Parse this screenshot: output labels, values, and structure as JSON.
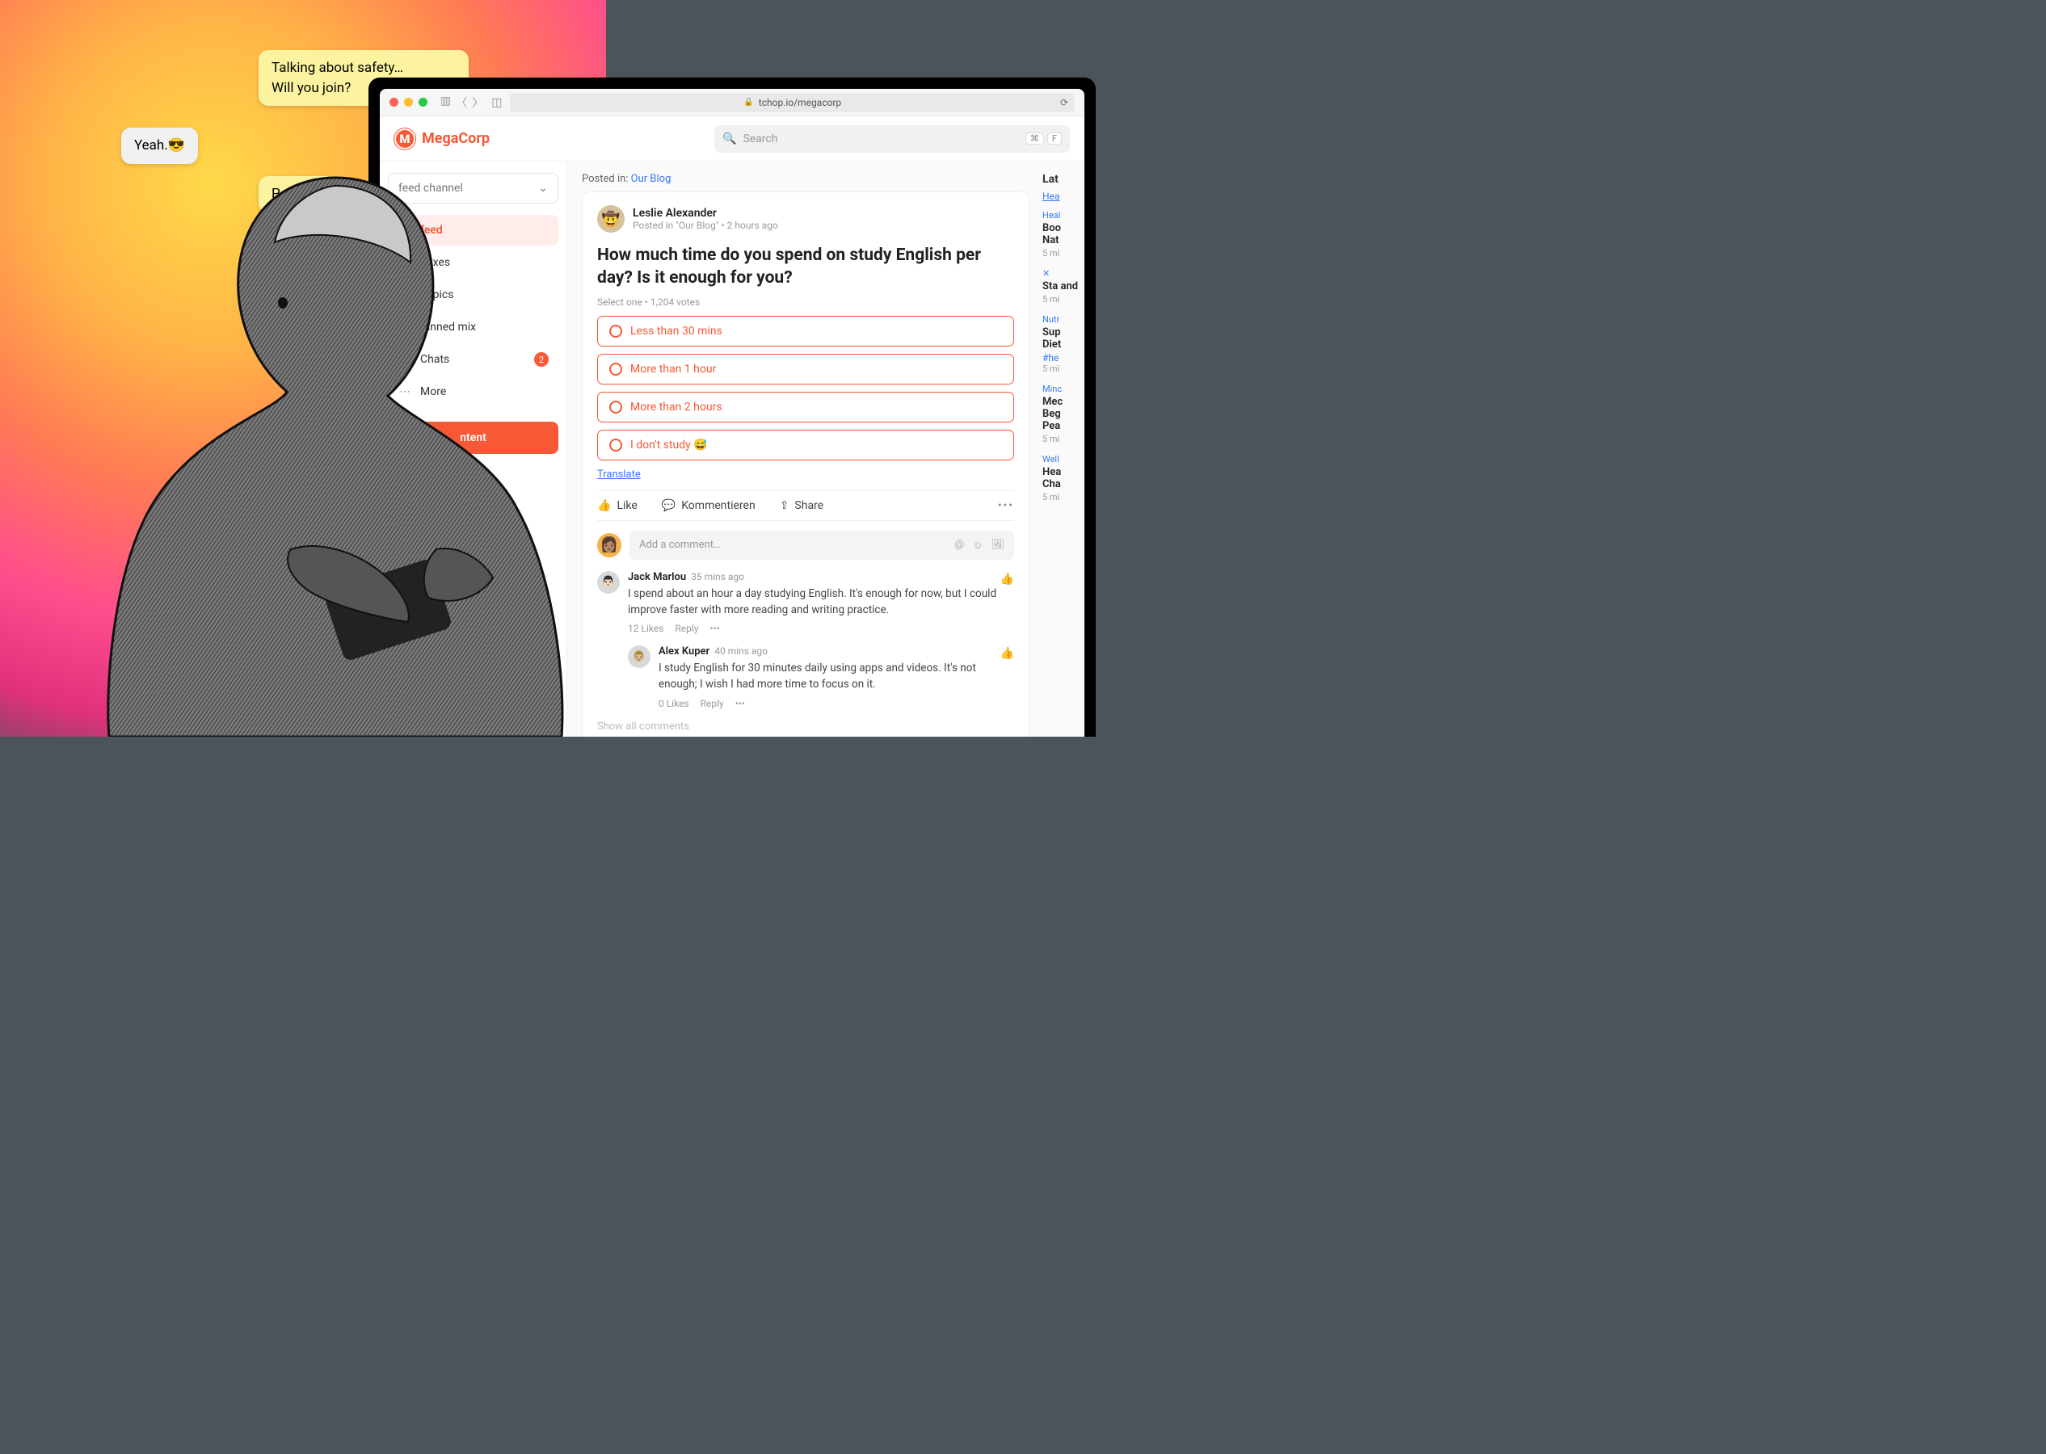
{
  "bubbles": {
    "safety_line1": "Talking about safety…",
    "safety_line2": "Will you join?",
    "yeah": "Yeah.😎",
    "perf": "Perf                    you"
  },
  "browser": {
    "url": "tchop.io/megacorp",
    "kbd1": "⌘",
    "kbd2": "F"
  },
  "header": {
    "brand_letter": "M",
    "brand": "MegaCorp",
    "search_placeholder": "Search"
  },
  "sidebar": {
    "channel_label": "feed channel",
    "items": [
      {
        "icon": "🏠",
        "label": "feed"
      },
      {
        "icon": "▦",
        "label": "Mixes"
      },
      {
        "icon": "☷",
        "label": "Topics"
      },
      {
        "icon": "📌",
        "label": "Pinned mix"
      },
      {
        "icon": "💬",
        "label": "Chats",
        "badge": "2"
      },
      {
        "icon": "⋯",
        "label": "More"
      }
    ],
    "new_content": "ntent"
  },
  "post": {
    "posted_in_prefix": "Posted in:",
    "posted_in_link": "Our Blog",
    "author": "Leslie Alexander",
    "meta": "Posted in \"Our Blog\" • 2 hours ago",
    "title": "How much time do you spend on study English per day? Is it enough for you?",
    "vote_meta": "Select one • 1,204 votes",
    "options": [
      "Less than 30 mins",
      "More than 1 hour",
      "More than 2 hours",
      "I don't study 😅"
    ],
    "translate": "Translate",
    "actions": {
      "like": "Like",
      "comment": "Kommentieren",
      "share": "Share"
    },
    "comment_placeholder": "Add a comment…",
    "comments": [
      {
        "name": "Jack Marlou",
        "time": "35 mins ago",
        "text": "I spend about an hour a day studying English. It's enough for now, but I could improve faster with more reading and writing practice.",
        "likes": "12  Likes",
        "reply": "Reply",
        "liked": true
      },
      {
        "name": "Alex Kuper",
        "time": "40 mins ago",
        "text": "I study English for 30 minutes daily using apps and videos. It's not enough; I wish I had more time to focus on it.",
        "likes": "0  Likes",
        "reply": "Reply",
        "liked": false
      }
    ],
    "show_all": "Show all comments"
  },
  "rail": {
    "heading": "Lat",
    "link": "Hea",
    "sections": [
      {
        "tag": "Heal",
        "title": "Boo\nNat",
        "when": "5 mi"
      },
      {
        "tag": "✕",
        "title": "Sta\nand",
        "when": "5 mi"
      },
      {
        "tag": "Nutr",
        "title": "Sup\nDiet",
        "hashtag": "#he",
        "when": "5 mi"
      },
      {
        "tag": "Minc",
        "title": "Mec\nBeg\nPea",
        "when": "5 mi"
      },
      {
        "tag": "Well",
        "title": "Hea\nCha",
        "when": "5 mi"
      }
    ]
  }
}
